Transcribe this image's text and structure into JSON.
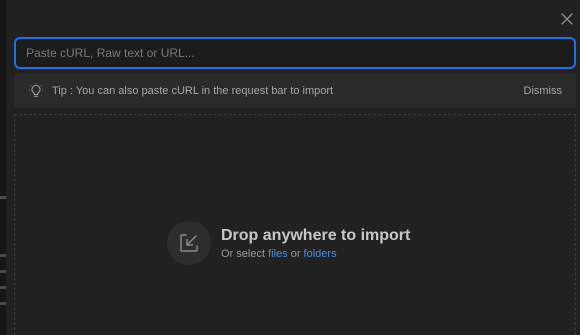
{
  "import_modal": {
    "input": {
      "placeholder": "Paste cURL, Raw text or URL...",
      "value": ""
    },
    "tip": {
      "text": "Tip : You can also paste cURL in the request bar to import",
      "dismiss_label": "Dismiss",
      "icon": "lightbulb-icon"
    },
    "drop_zone": {
      "title": "Drop anywhere to import",
      "subtitle_prefix": "Or select",
      "files_link": "files",
      "or_text": "or",
      "folders_link": "folders",
      "icon": "import-icon"
    },
    "close_icon": "close-icon"
  },
  "colors": {
    "accent": "#1f6feb",
    "link": "#4a90e2",
    "modal_bg": "#212121",
    "tip_bg": "#2a2a2a"
  }
}
